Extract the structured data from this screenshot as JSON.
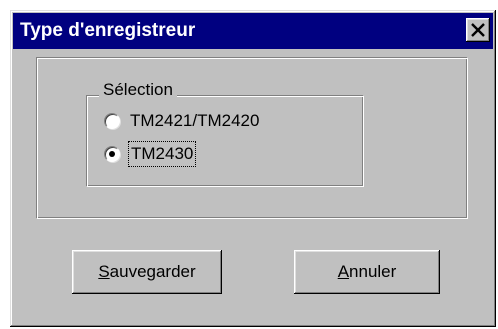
{
  "window": {
    "title": "Type d'enregistreur",
    "close_icon": "close-icon"
  },
  "selection": {
    "legend": "Sélection",
    "options": [
      {
        "label": "TM2421/TM2420",
        "checked": false
      },
      {
        "label": "TM2430",
        "checked": true
      }
    ]
  },
  "buttons": {
    "save": {
      "mnemonic": "S",
      "rest": "auvegarder"
    },
    "cancel": {
      "mnemonic": "A",
      "rest": "nnuler"
    }
  },
  "colors": {
    "titlebar": "#000080",
    "face": "#c0c0c0"
  }
}
